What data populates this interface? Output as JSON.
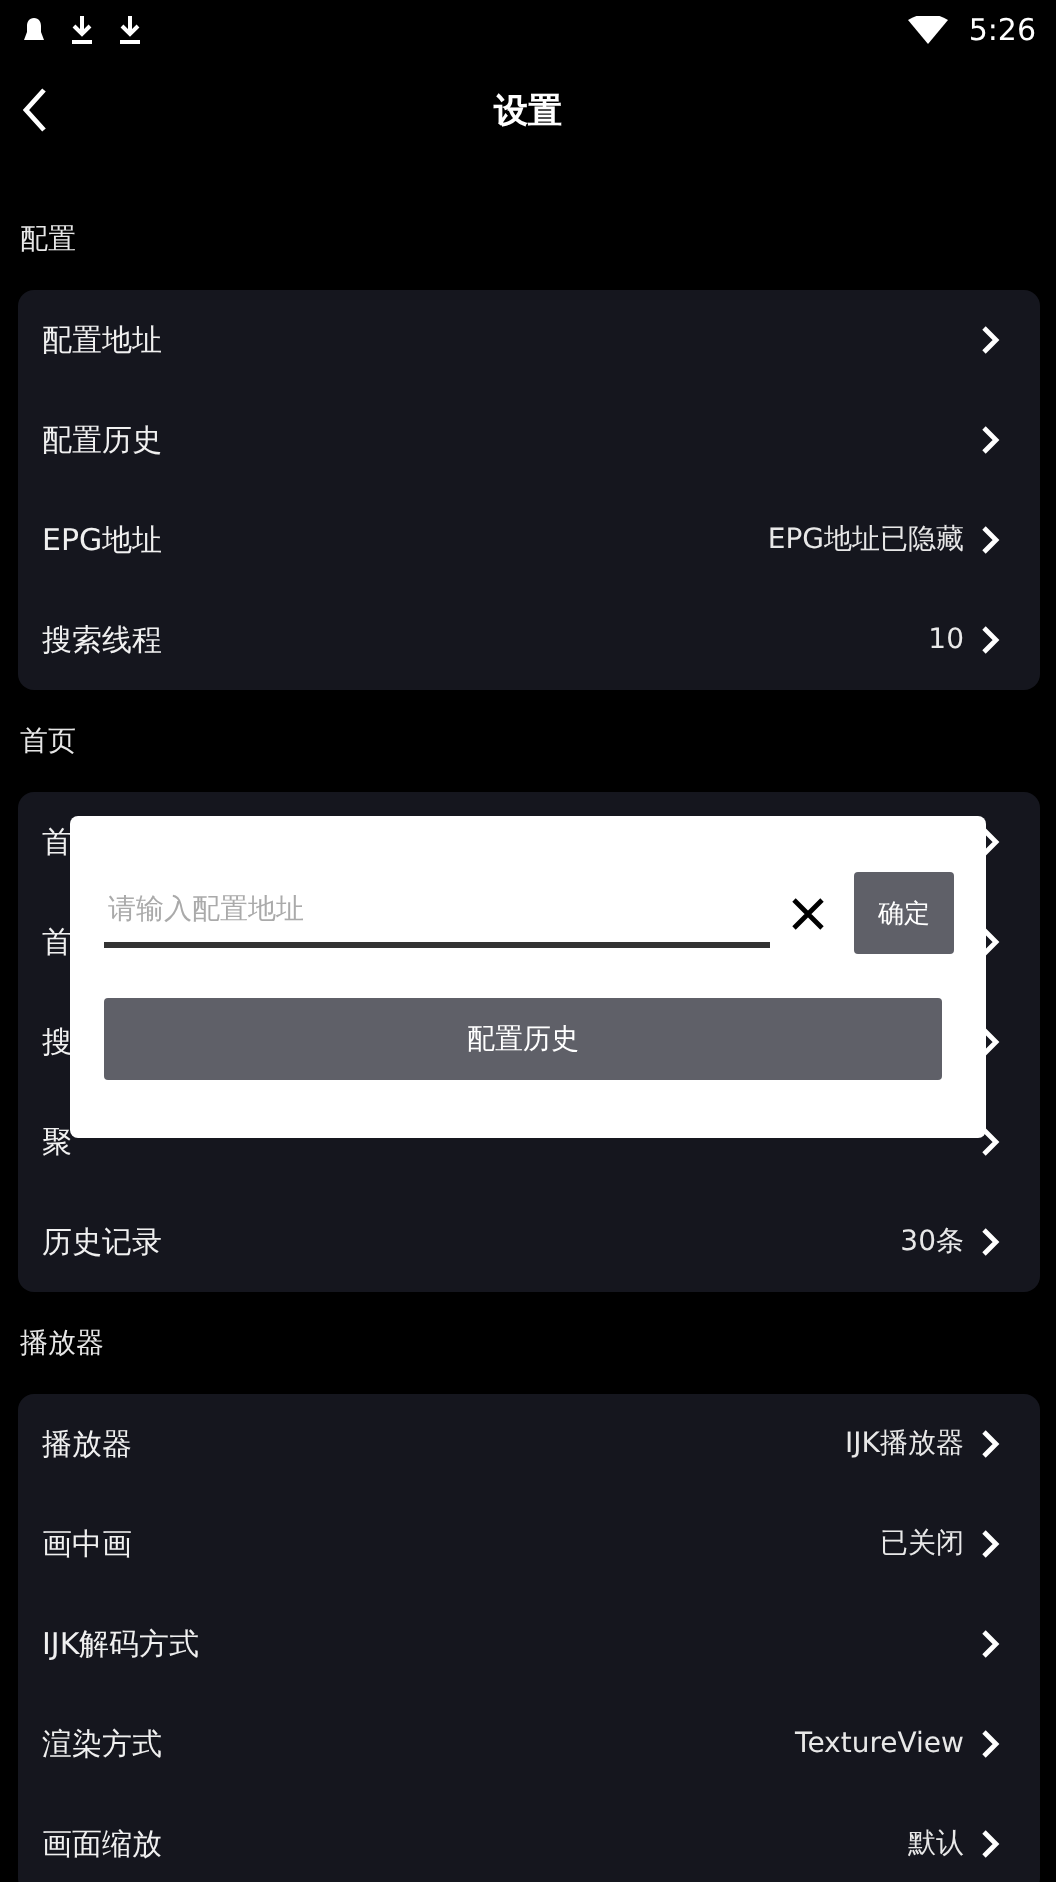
{
  "status_bar": {
    "time": "5:26"
  },
  "header": {
    "title": "设置"
  },
  "sections": [
    {
      "title": "配置",
      "rows": [
        {
          "label": "配置地址"
        },
        {
          "label": "配置历史"
        },
        {
          "label": "EPG地址",
          "value": "EPG地址已隐藏"
        },
        {
          "label": "搜索线程",
          "value": "10"
        }
      ]
    },
    {
      "title": "首页",
      "rows": [
        {
          "label": "首"
        },
        {
          "label": "首"
        },
        {
          "label": "搜"
        },
        {
          "label": "聚"
        },
        {
          "label": "历史记录",
          "value": "30条"
        }
      ]
    },
    {
      "title": "播放器",
      "rows": [
        {
          "label": "播放器",
          "value": "IJK播放器"
        },
        {
          "label": "画中画",
          "value": "已关闭"
        },
        {
          "label": "IJK解码方式"
        },
        {
          "label": "渲染方式",
          "value": "TextureView"
        },
        {
          "label": "画面缩放",
          "value": "默认"
        }
      ]
    }
  ],
  "dialog": {
    "placeholder": "请输入配置地址",
    "confirm": "确定",
    "history_button": "配置历史"
  }
}
